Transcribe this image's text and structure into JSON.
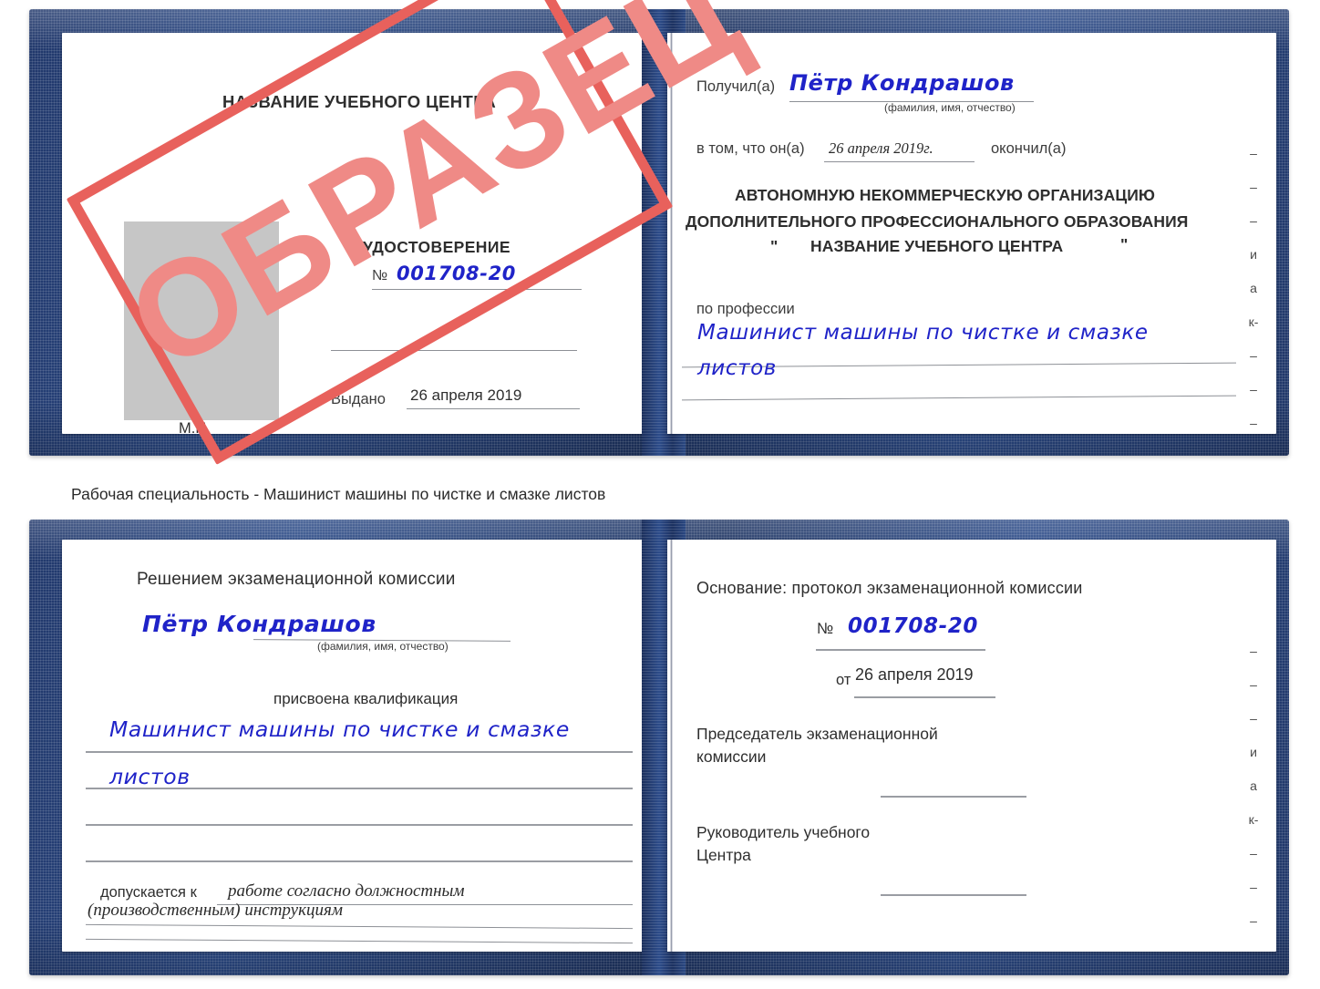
{
  "document": {
    "kind": "certificate-scan",
    "caption": "Рабочая специальность - Машинист машины по чистке и смазке листов",
    "watermark": {
      "text": "ОБРАЗЕЦ",
      "color": "#ef8a86",
      "frame_color": "#e8615c"
    },
    "cover_color": "#23396c",
    "handwriting_color": "#1f23c8"
  },
  "certificate_top": {
    "left_page": {
      "org_title": "НАЗВАНИЕ УЧЕБНОГО ЦЕНТРА",
      "doc_type": "УДОСТОВЕРЕНИЕ",
      "number_label": "№",
      "number_value": "001708-20",
      "issued_label": "Выдано",
      "issued_value": "26 апреля 2019",
      "seal_label": "М.П.",
      "photo_placeholder": ""
    },
    "right_page": {
      "received_label": "Получил(а)",
      "received_value": "Пётр Кондрашов",
      "fio_hint": "(фамилия, имя, отчество)",
      "that_he_label": "в том, что он(а)",
      "that_he_value": "26 апреля 2019г.",
      "finished_label": "окончил(а)",
      "org_line1": "АВТОНОМНУЮ НЕКОММЕРЧЕСКУЮ ОРГАНИЗАЦИЮ",
      "org_line2": "ДОПОЛНИТЕЛЬНОГО ПРОФЕССИОНАЛЬНОГО ОБРАЗОВАНИЯ",
      "org_quote_open": "\"",
      "org_line3": "НАЗВАНИЕ УЧЕБНОГО ЦЕНТРА",
      "org_quote_close": "\"",
      "profession_label": "по профессии",
      "profession_line1": "Машинист машины по чистке и смазке",
      "profession_line2": "листов",
      "edge_marks": [
        "–",
        "–",
        "–",
        "и",
        "а",
        "к-",
        "–",
        "–",
        "–",
        "–"
      ]
    }
  },
  "certificate_bottom": {
    "left_page": {
      "heading": "Решением экзаменационной комиссии",
      "name_value": "Пётр Кондрашов",
      "fio_hint": "(фамилия, имя, отчество)",
      "qualification_label": "присвоена квалификация",
      "qualification_line1": "Машинист машины по чистке и смазке",
      "qualification_line2": "листов",
      "admitted_label": "допускается к",
      "admitted_line1": "работе согласно должностным",
      "admitted_line2": "(производственным) инструкциям"
    },
    "right_page": {
      "basis_label": "Основание: протокол экзаменационной комиссии",
      "number_label": "№",
      "number_value": "001708-20",
      "date_label": "от",
      "date_value": "26 апреля 2019",
      "chair_line1": "Председатель экзаменационной",
      "chair_line2": "комиссии",
      "head_line1": "Руководитель учебного",
      "head_line2": "Центра",
      "edge_marks": [
        "–",
        "–",
        "–",
        "и",
        "а",
        "к-",
        "–",
        "–",
        "–",
        "–"
      ]
    }
  }
}
